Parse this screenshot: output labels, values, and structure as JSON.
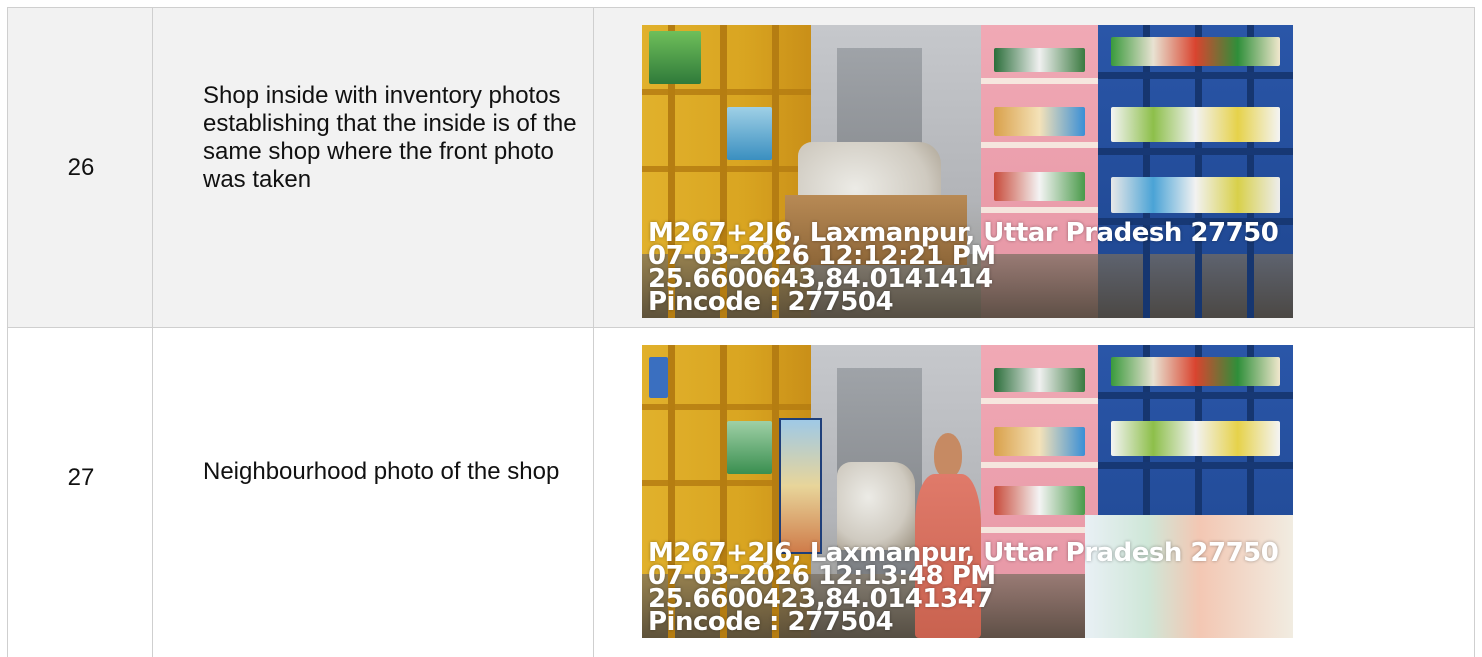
{
  "rows": [
    {
      "number": "26",
      "description": "Shop inside with inventory photos establishing that the inside is of the same shop where the front photo was taken",
      "photo": {
        "address": "M267+2J6, Laxmanpur, Uttar Pradesh 27750",
        "datetime": "07-03-2026 12:12:21 PM",
        "coordinates": "25.6600643,84.0141414",
        "pincode": "Pincode : 277504"
      }
    },
    {
      "number": "27",
      "description": "Neighbourhood photo of the shop",
      "photo": {
        "address": "M267+2J6, Laxmanpur, Uttar Pradesh 27750",
        "datetime": "07-03-2026 12:13:48 PM",
        "coordinates": "25.6600423,84.0141347",
        "pincode": "Pincode : 277504"
      }
    }
  ]
}
